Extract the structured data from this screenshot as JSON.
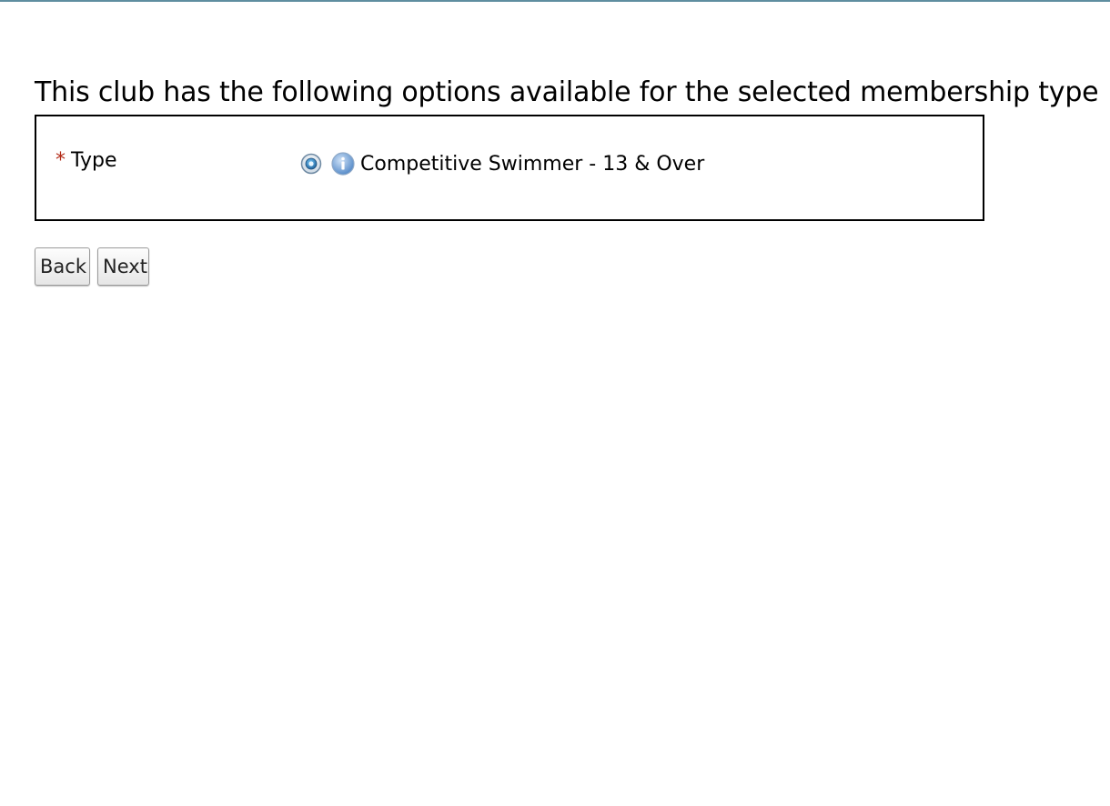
{
  "page": {
    "heading": "This club has the following options available for the selected membership type"
  },
  "form": {
    "required_marker": "*",
    "type_label": "Type",
    "options": [
      {
        "label": "Competitive Swimmer - 13 & Over",
        "selected": true,
        "icons": [
          "radio-selected-icon",
          "info-icon"
        ]
      }
    ]
  },
  "buttons": {
    "back_label": "Back",
    "next_label": "Next"
  },
  "colors": {
    "top_rule": "#5f8ea0",
    "required_star": "#b22a16",
    "radio_accent": "#2f78b8",
    "info_icon": "#4f86c6"
  }
}
